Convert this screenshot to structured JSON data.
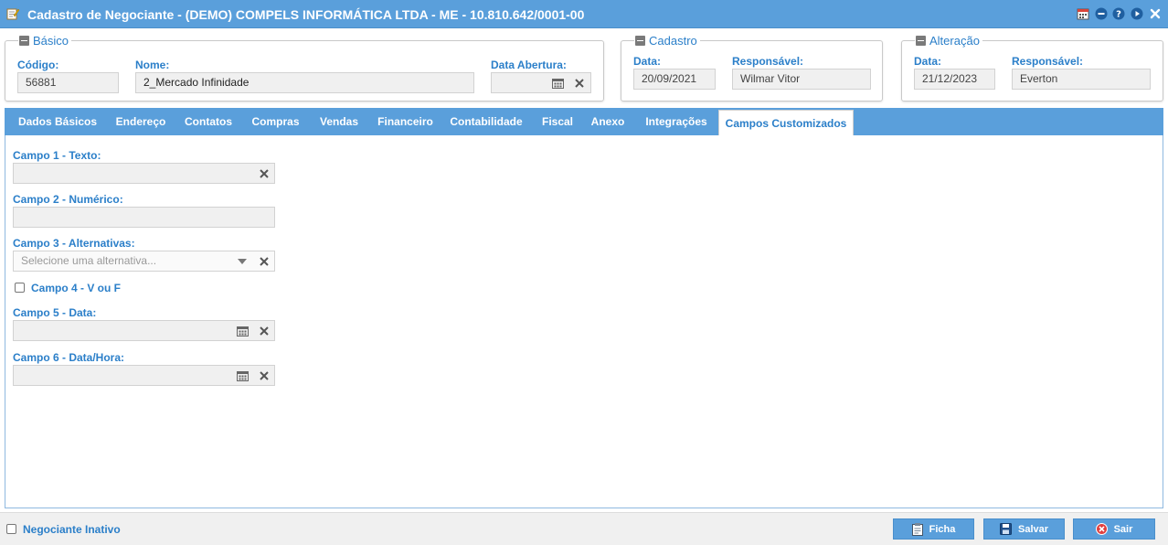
{
  "window": {
    "title": "Cadastro de Negociante - (DEMO) COMPELS INFORMÁTICA LTDA - ME - 10.810.642/0001-00"
  },
  "basico": {
    "legend": "Básico",
    "codigo_label": "Código:",
    "codigo_value": "56881",
    "nome_label": "Nome:",
    "nome_value": "2_Mercado Infinidade",
    "data_abertura_label": "Data Abertura:",
    "data_abertura_value": ""
  },
  "cadastro": {
    "legend": "Cadastro",
    "data_label": "Data:",
    "data_value": "20/09/2021",
    "responsavel_label": "Responsável:",
    "responsavel_value": "Wilmar Vitor"
  },
  "alteracao": {
    "legend": "Alteração",
    "data_label": "Data:",
    "data_value": "21/12/2023",
    "responsavel_label": "Responsável:",
    "responsavel_value": "Everton"
  },
  "tabs": [
    {
      "label": "Dados Básicos"
    },
    {
      "label": "Endereço"
    },
    {
      "label": "Contatos"
    },
    {
      "label": "Compras"
    },
    {
      "label": "Vendas"
    },
    {
      "label": "Financeiro"
    },
    {
      "label": "Contabilidade"
    },
    {
      "label": "Fiscal"
    },
    {
      "label": "Anexo"
    },
    {
      "label": "Integrações"
    },
    {
      "label": "Campos Customizados"
    }
  ],
  "active_tab": "Campos Customizados",
  "custom_fields": {
    "campo1_label": "Campo 1 - Texto:",
    "campo1_value": "",
    "campo2_label": "Campo 2 - Numérico:",
    "campo2_value": "",
    "campo3_label": "Campo 3 - Alternativas:",
    "campo3_placeholder": "Selecione uma alternativa...",
    "campo4_label": "Campo 4 - V ou F",
    "campo4_checked": false,
    "campo5_label": "Campo 5 - Data:",
    "campo5_value": "",
    "campo6_label": "Campo 6 - Data/Hora:",
    "campo6_value": ""
  },
  "footer": {
    "inativo_label": "Negociante Inativo",
    "inativo_checked": false,
    "ficha_label": "Ficha",
    "salvar_label": "Salvar",
    "sair_label": "Sair"
  },
  "colors": {
    "accent": "#5a9fdb",
    "label_blue": "#2b7fc9",
    "sair_icon": "#e04040"
  },
  "icons": {
    "title": "edit-form-icon",
    "toolbar": [
      "calendar-icon",
      "minimize-icon",
      "help-icon",
      "forward-icon",
      "close-icon"
    ],
    "field_clear": "clear-x-icon",
    "field_calendar": "calendar-icon",
    "field_dropdown": "caret-down-icon",
    "ficha": "clipboard-icon",
    "salvar": "floppy-disk-icon",
    "sair": "exit-icon"
  }
}
